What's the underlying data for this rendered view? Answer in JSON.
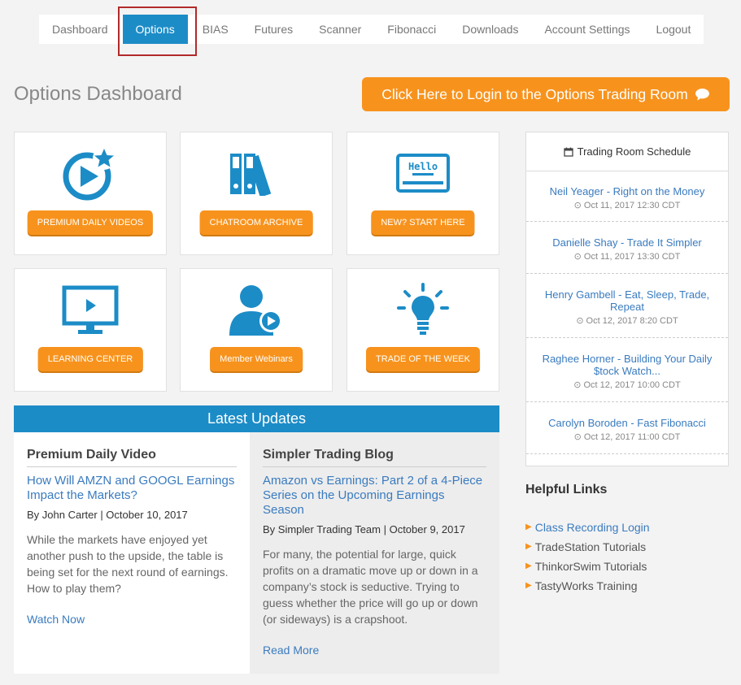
{
  "nav": {
    "items": [
      "Dashboard",
      "Options",
      "BIAS",
      "Futures",
      "Scanner",
      "Fibonacci",
      "Downloads",
      "Account Settings",
      "Logout"
    ],
    "active_index": 1
  },
  "page_title": "Options Dashboard",
  "login_button": "Click Here to Login to the Options Trading Room",
  "tiles": [
    {
      "label": "PREMIUM DAILY VIDEOS",
      "icon": "play-star-icon"
    },
    {
      "label": "CHATROOM ARCHIVE",
      "icon": "binders-icon"
    },
    {
      "label": "NEW? START HERE",
      "icon": "hello-badge-icon"
    },
    {
      "label": "LEARNING CENTER",
      "icon": "monitor-play-icon"
    },
    {
      "label": "Member Webinars",
      "icon": "person-play-icon"
    },
    {
      "label": "TRADE OF THE WEEK",
      "icon": "lightbulb-icon"
    }
  ],
  "updates": {
    "title": "Latest Updates",
    "left": {
      "heading": "Premium Daily Video",
      "post_title": "How Will AMZN and GOOGL Earnings Impact the Markets?",
      "byline": "By John Carter | October 10, 2017",
      "excerpt": "While the markets have enjoyed yet another push to the upside, the table is being set for the next round of earnings. How to play them?",
      "link": "Watch Now"
    },
    "right": {
      "heading": "Simpler Trading Blog",
      "post_title": "Amazon vs Earnings: Part 2 of a 4-Piece Series on the Upcoming Earnings Season",
      "byline": "By Simpler Trading Team | October 9, 2017",
      "excerpt": "For many, the potential for large, quick profits on a dramatic move up or down in a company’s stock is seductive. Trying to guess whether the price will go up or down (or sideways) is a crapshoot.",
      "link": "Read More"
    }
  },
  "schedule": {
    "title": "Trading Room Schedule",
    "items": [
      {
        "title": "Neil Yeager - Right on the Money",
        "date": "Oct 11, 2017 12:30 CDT"
      },
      {
        "title": "Danielle Shay - Trade It Simpler",
        "date": "Oct 11, 2017 13:30 CDT"
      },
      {
        "title": "Henry Gambell - Eat, Sleep, Trade, Repeat",
        "date": "Oct 12, 2017 8:20 CDT"
      },
      {
        "title": "Raghee Horner - Building Your Daily $tock Watch...",
        "date": "Oct 12, 2017 10:00 CDT"
      },
      {
        "title": "Carolyn Boroden - Fast Fibonacci",
        "date": "Oct 12, 2017 11:00 CDT"
      }
    ]
  },
  "helpful_links": {
    "title": "Helpful Links",
    "items": [
      "Class Recording Login",
      "TradeStation Tutorials",
      "ThinkorSwim Tutorials",
      "TastyWorks Training"
    ]
  },
  "colors": {
    "brand_blue": "#1c8cc7",
    "accent_orange": "#f7931d",
    "link_blue": "#3a7bbf"
  }
}
